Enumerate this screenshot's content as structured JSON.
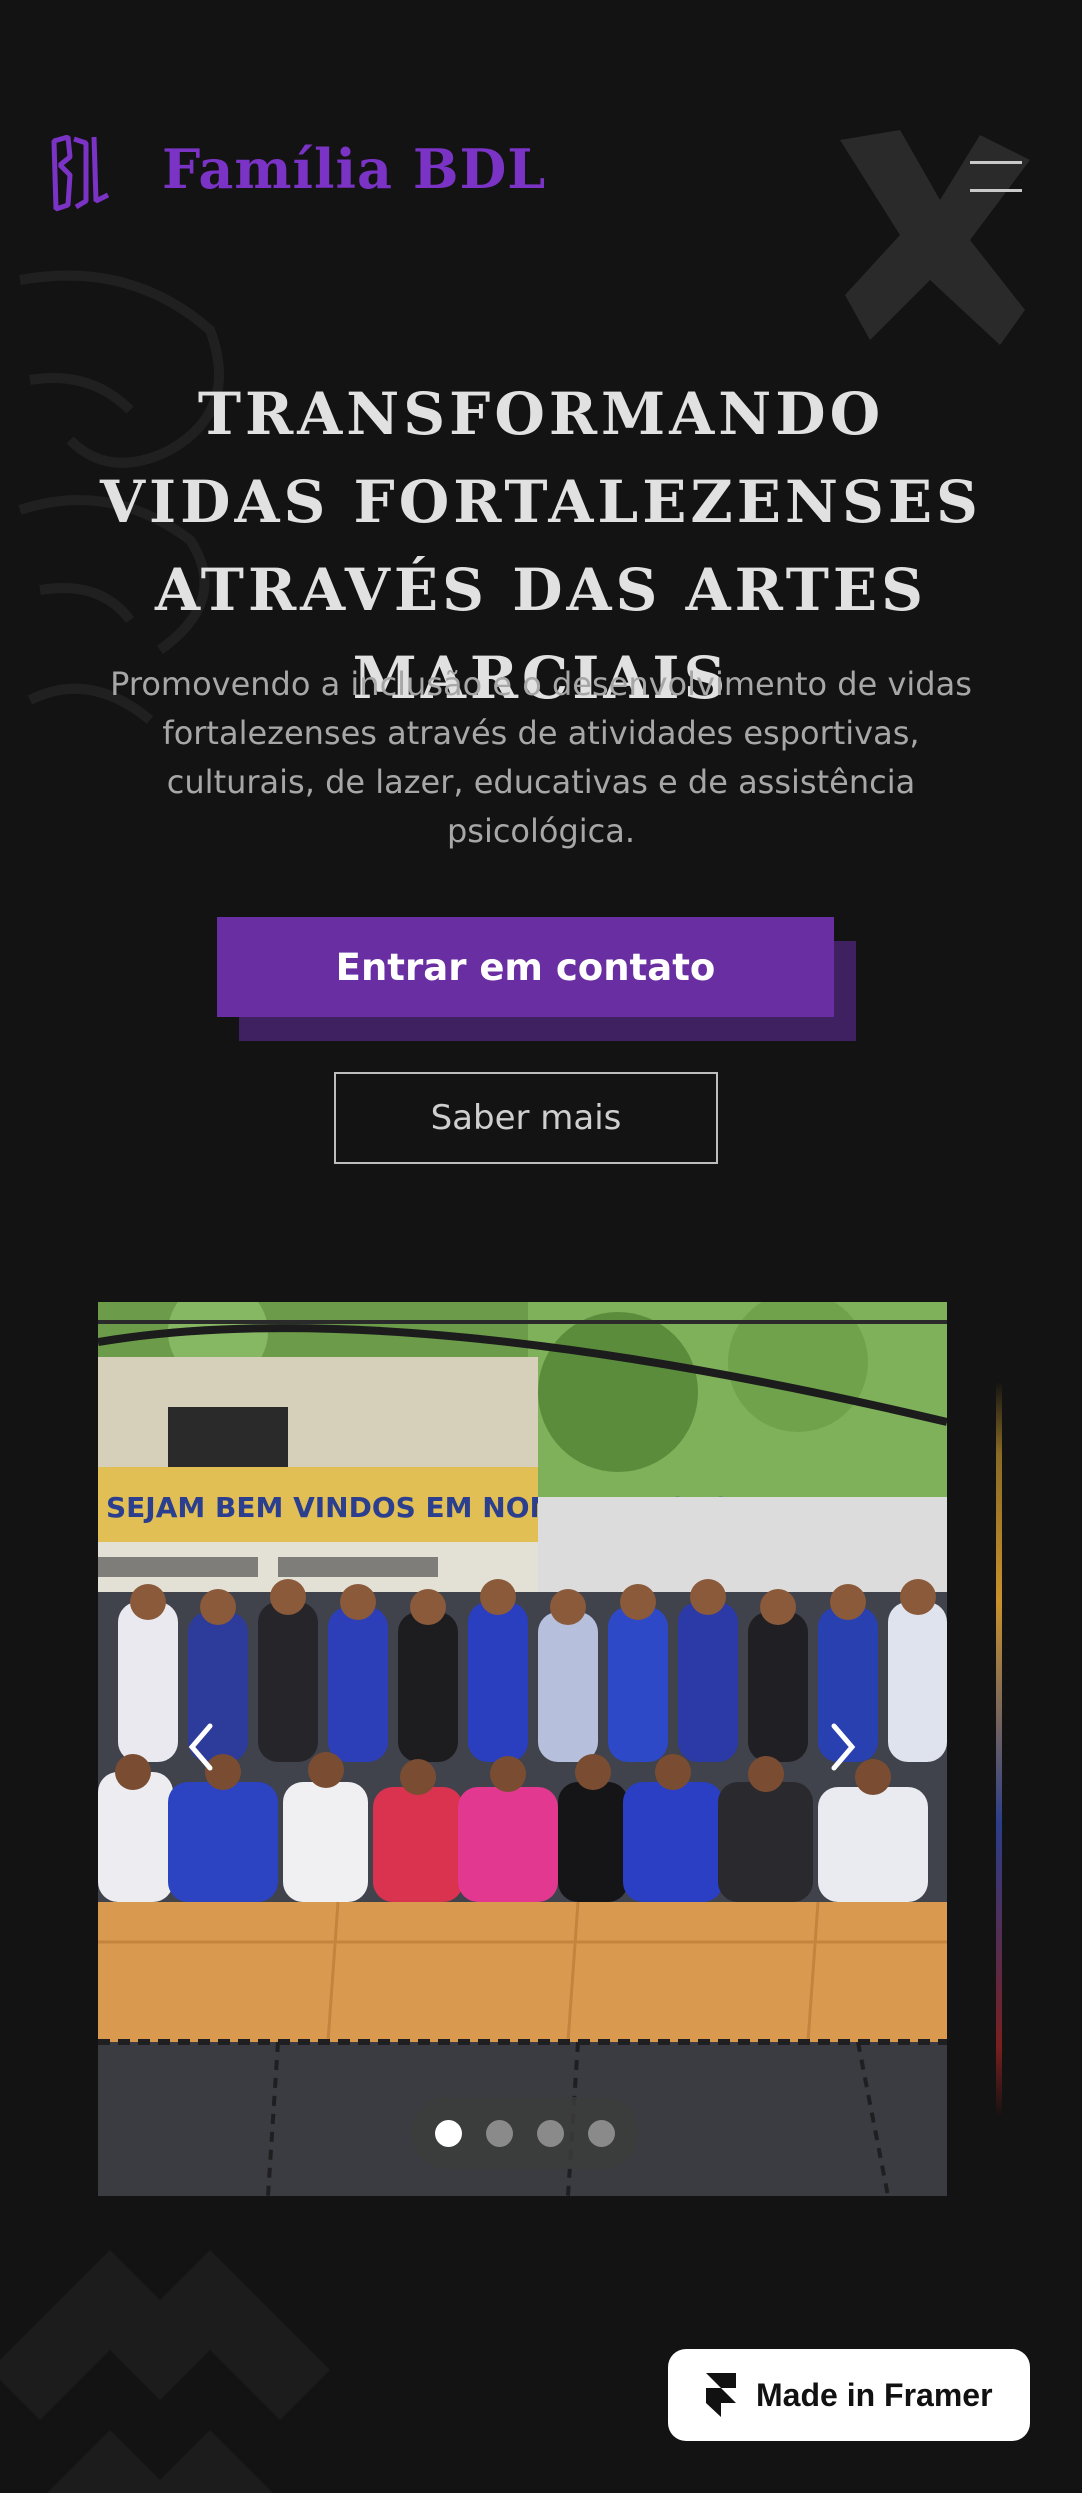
{
  "header": {
    "logo_text": "BDL",
    "brand": "Família BDL"
  },
  "hero": {
    "title": "Transformando vidas fortalezenses através das artes marciais",
    "subtitle": "Promovendo a inclusão e o desenvolvimento de vidas fortalezenses através de atividades esportivas, culturais, de lazer, educativas e de assistência psicológica.",
    "primary_button": "Entrar em contato",
    "secondary_button": "Saber mais"
  },
  "carousel": {
    "photo_banner_text": "SEJAM BEM VINDOS EM NOME DE JESUS",
    "slide_count": 4,
    "active_index": 0
  },
  "badge": {
    "label": "Made in Framer"
  },
  "colors": {
    "background": "#131313",
    "accent": "#6a2ea3",
    "brand": "#7b33c6",
    "text_light": "#e1e1e1"
  }
}
